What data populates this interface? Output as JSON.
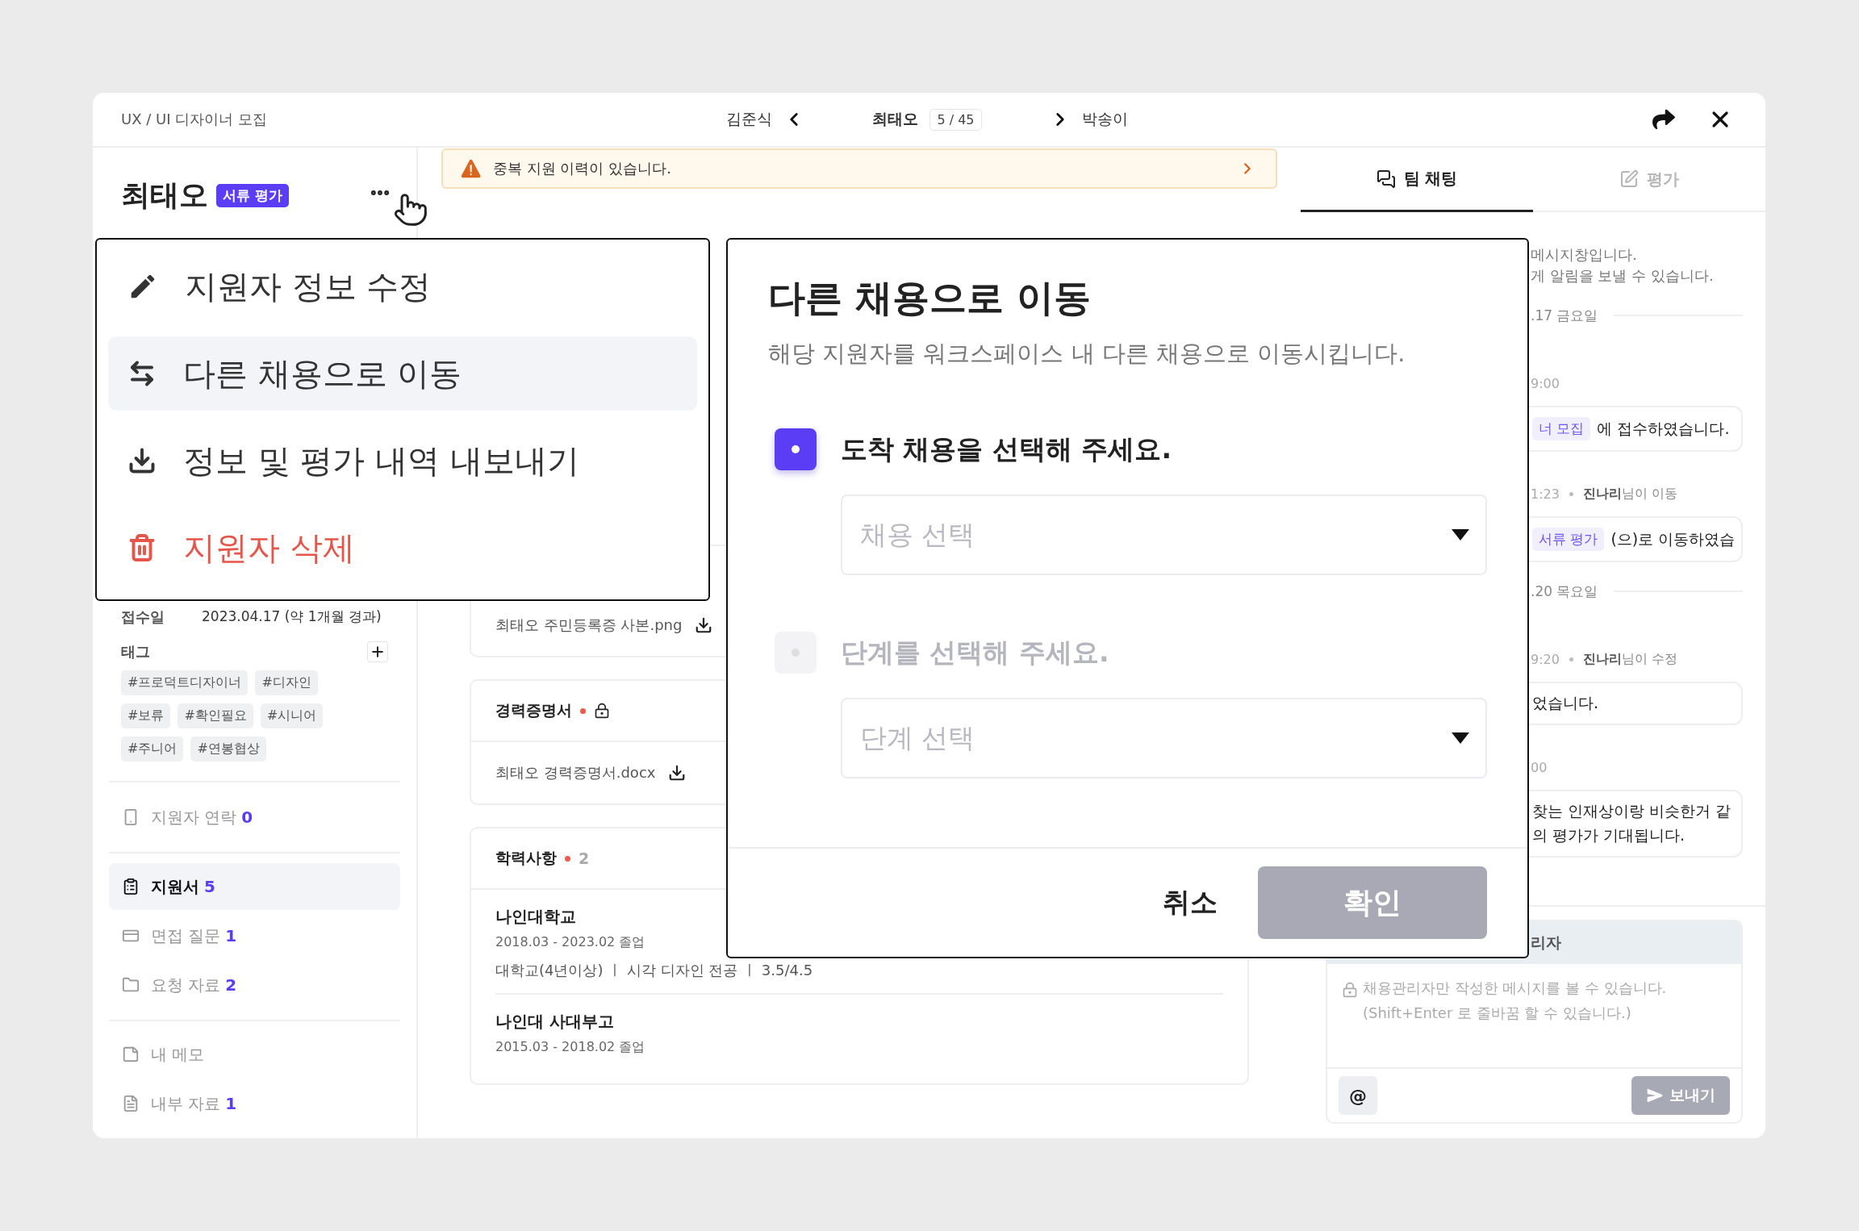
{
  "header": {
    "title": "UX / UI 디자이너 모집",
    "prev_name": "김준식",
    "current_name": "최태오",
    "position": "5 / 45",
    "next_name": "박송이"
  },
  "candidate": {
    "name": "최태오",
    "stage": "서류 평가"
  },
  "menu": {
    "items": [
      {
        "label": "지원자 정보 수정",
        "kind": "edit",
        "selected": false
      },
      {
        "label": "다른 채용으로 이동",
        "kind": "move",
        "selected": true
      },
      {
        "label": "정보 및 평가 내역 내보내기",
        "kind": "export",
        "selected": false
      },
      {
        "label": "지원자 삭제",
        "kind": "delete",
        "selected": false
      }
    ]
  },
  "info": {
    "received_label": "접수일",
    "received_value": "2023.04.17 (약 1개월 경과)",
    "tags_label": "태그",
    "tags": [
      "#프로덕트디자이너",
      "#디자인",
      "#보류",
      "#확인필요",
      "#시니어",
      "#주니어",
      "#연봉협상"
    ]
  },
  "nav_groups": [
    {
      "items": [
        {
          "label": "지원자 연락",
          "count": "0",
          "kind": "phone",
          "selected": false
        }
      ]
    },
    {
      "items": [
        {
          "label": "지원서",
          "count": "5",
          "kind": "form",
          "selected": true
        },
        {
          "label": "면접 질문",
          "count": "1",
          "kind": "card",
          "selected": false
        },
        {
          "label": "요청 자료",
          "count": "2",
          "kind": "folder",
          "selected": false
        }
      ]
    },
    {
      "items": [
        {
          "label": "내 메모",
          "kind": "memo",
          "selected": false
        },
        {
          "label": "내부 자료",
          "count": "1",
          "kind": "doc",
          "selected": false
        }
      ]
    }
  ],
  "alert": {
    "text": "중복 지원 이력이 있습니다."
  },
  "documents": [
    {
      "file": "최태오 주민등록증 사본.png"
    },
    {
      "title": "경력증명서",
      "required": true,
      "locked": true,
      "file": "최태오 경력증명서.docx"
    }
  ],
  "education": {
    "title": "학력사항",
    "required": true,
    "count": "2",
    "schools": [
      {
        "name": "나인대학교",
        "period": "2018.03 - 2023.02 졸업",
        "detail": "대학교(4년이상) ㅣ 시각 디자인 전공 ㅣ 3.5/4.5"
      },
      {
        "name": "나인대 사대부고",
        "period": "2015.03 - 2018.02 졸업"
      }
    ]
  },
  "tabs": [
    {
      "label": "팀 채팅",
      "kind": "chat",
      "selected": true
    },
    {
      "label": "평가",
      "kind": "evaluation",
      "selected": false
    }
  ],
  "chat": {
    "notice": [
      "메시지창입니다.",
      "게 알림을 보낼 수 있습니다."
    ],
    "entries": [
      {
        "kind": "date",
        "text": ".17 금요일"
      },
      {
        "kind": "meta",
        "time": "9:00"
      },
      {
        "kind": "bubble",
        "tag": "너 모집",
        "lines": [
          "에 접수하였습니다."
        ]
      },
      {
        "kind": "meta",
        "time": "1:23",
        "note": "**진나리**님이 이동"
      },
      {
        "kind": "bubble",
        "tag": "서류 평가",
        "lines": [
          "(으)로 이동하였습"
        ]
      },
      {
        "kind": "date",
        "text": ".20 목요일"
      },
      {
        "kind": "meta",
        "time": "9:20",
        "note": "**진나리**님이 수정"
      },
      {
        "kind": "bubble",
        "lines": [
          "었습니다."
        ]
      },
      {
        "kind": "meta",
        "time": "00"
      },
      {
        "kind": "bubble",
        "lines": [
          "찾는 인재상이랑 비슷한거 같",
          "의 평가가 기대됩니다."
        ]
      }
    ]
  },
  "composer": {
    "recipient": "리자",
    "placeholder": "채용관리자만 작성한 메시지를 볼 수 있습니다.\n(Shift+Enter 로 줄바꿈 할 수 있습니다.)",
    "mention": "@",
    "send": "보내기"
  },
  "dialog": {
    "title": "다른 채용으로 이동",
    "description": "해당 지원자를 워크스페이스 내 다른 채용으로 이동시킵니다.",
    "steps": [
      {
        "label": "도착 채용을 선택해 주세요.",
        "active": true,
        "placeholder": "채용 선택"
      },
      {
        "label": "단계를 선택해 주세요.",
        "active": false,
        "placeholder": "단계 선택"
      }
    ],
    "cancel": "취소",
    "confirm": "확인",
    "confirm_disabled": true
  }
}
